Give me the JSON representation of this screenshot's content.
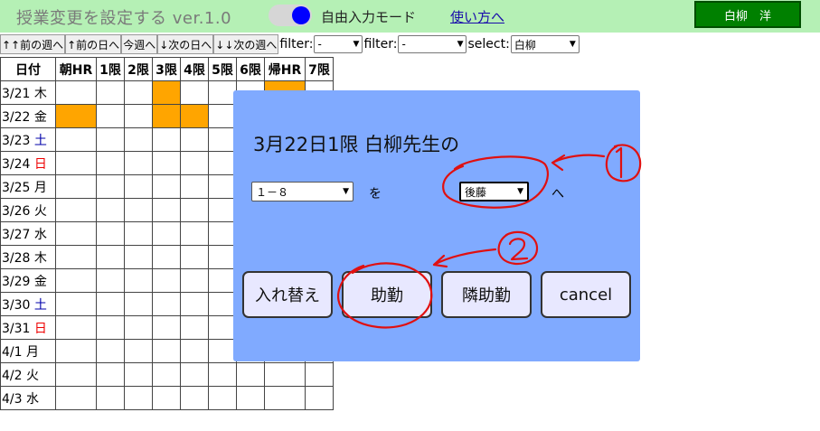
{
  "header": {
    "title": "授業変更を設定する ver.1.0",
    "mode_label": "自由入力モード",
    "help_link": "使い方へ",
    "user_button": "白柳　洋"
  },
  "nav": {
    "prev_week": "↑↑前の週へ",
    "prev_day": "↑前の日へ",
    "this_week": "今週へ",
    "next_day": "↓次の日へ",
    "next_week": "↓↓次の週へ",
    "filter_label": "filter:",
    "filter1_value": "-",
    "filter2_value": "-",
    "select_label": "select:",
    "select_value": "白柳"
  },
  "grid": {
    "headers": [
      "日付",
      "朝HR",
      "1限",
      "2限",
      "3限",
      "4限",
      "5限",
      "6限",
      "帰HR",
      "7限"
    ],
    "rows": [
      {
        "date": "3/21",
        "dow": "木",
        "dow_color": "normal"
      },
      {
        "date": "3/22",
        "dow": "金",
        "dow_color": "normal"
      },
      {
        "date": "3/23",
        "dow": "土",
        "dow_color": "blue"
      },
      {
        "date": "3/24",
        "dow": "日",
        "dow_color": "red"
      },
      {
        "date": "3/25",
        "dow": "月",
        "dow_color": "normal"
      },
      {
        "date": "3/26",
        "dow": "火",
        "dow_color": "normal"
      },
      {
        "date": "3/27",
        "dow": "水",
        "dow_color": "normal"
      },
      {
        "date": "3/28",
        "dow": "木",
        "dow_color": "normal"
      },
      {
        "date": "3/29",
        "dow": "金",
        "dow_color": "normal"
      },
      {
        "date": "3/30",
        "dow": "土",
        "dow_color": "blue"
      },
      {
        "date": "3/31",
        "dow": "日",
        "dow_color": "red"
      },
      {
        "date": "4/1",
        "dow": "月",
        "dow_color": "normal"
      },
      {
        "date": "4/2",
        "dow": "火",
        "dow_color": "normal"
      },
      {
        "date": "4/3",
        "dow": "水",
        "dow_color": "normal"
      }
    ],
    "highlighted_cells": [
      [
        0,
        4
      ],
      [
        0,
        8
      ],
      [
        1,
        1
      ],
      [
        1,
        4
      ],
      [
        1,
        5
      ]
    ]
  },
  "modal": {
    "title": "3月22日1限 白柳先生の",
    "class_select": "１－８",
    "wo": "を",
    "teacher_select": "後藤",
    "he": "へ",
    "btn_swap": "入れ替え",
    "btn_assist": "助勤",
    "btn_neighbor_assist": "隣助勤",
    "btn_cancel": "cancel"
  },
  "annotations": {
    "label_1": "1",
    "label_2": "2",
    "color": "#e01010"
  },
  "colors": {
    "header_bg": "#b5f0b5",
    "user_btn": "#008000",
    "highlight": "#ffa500",
    "modal_bg": "#80aaff",
    "modal_btn": "#e8e8ff"
  }
}
